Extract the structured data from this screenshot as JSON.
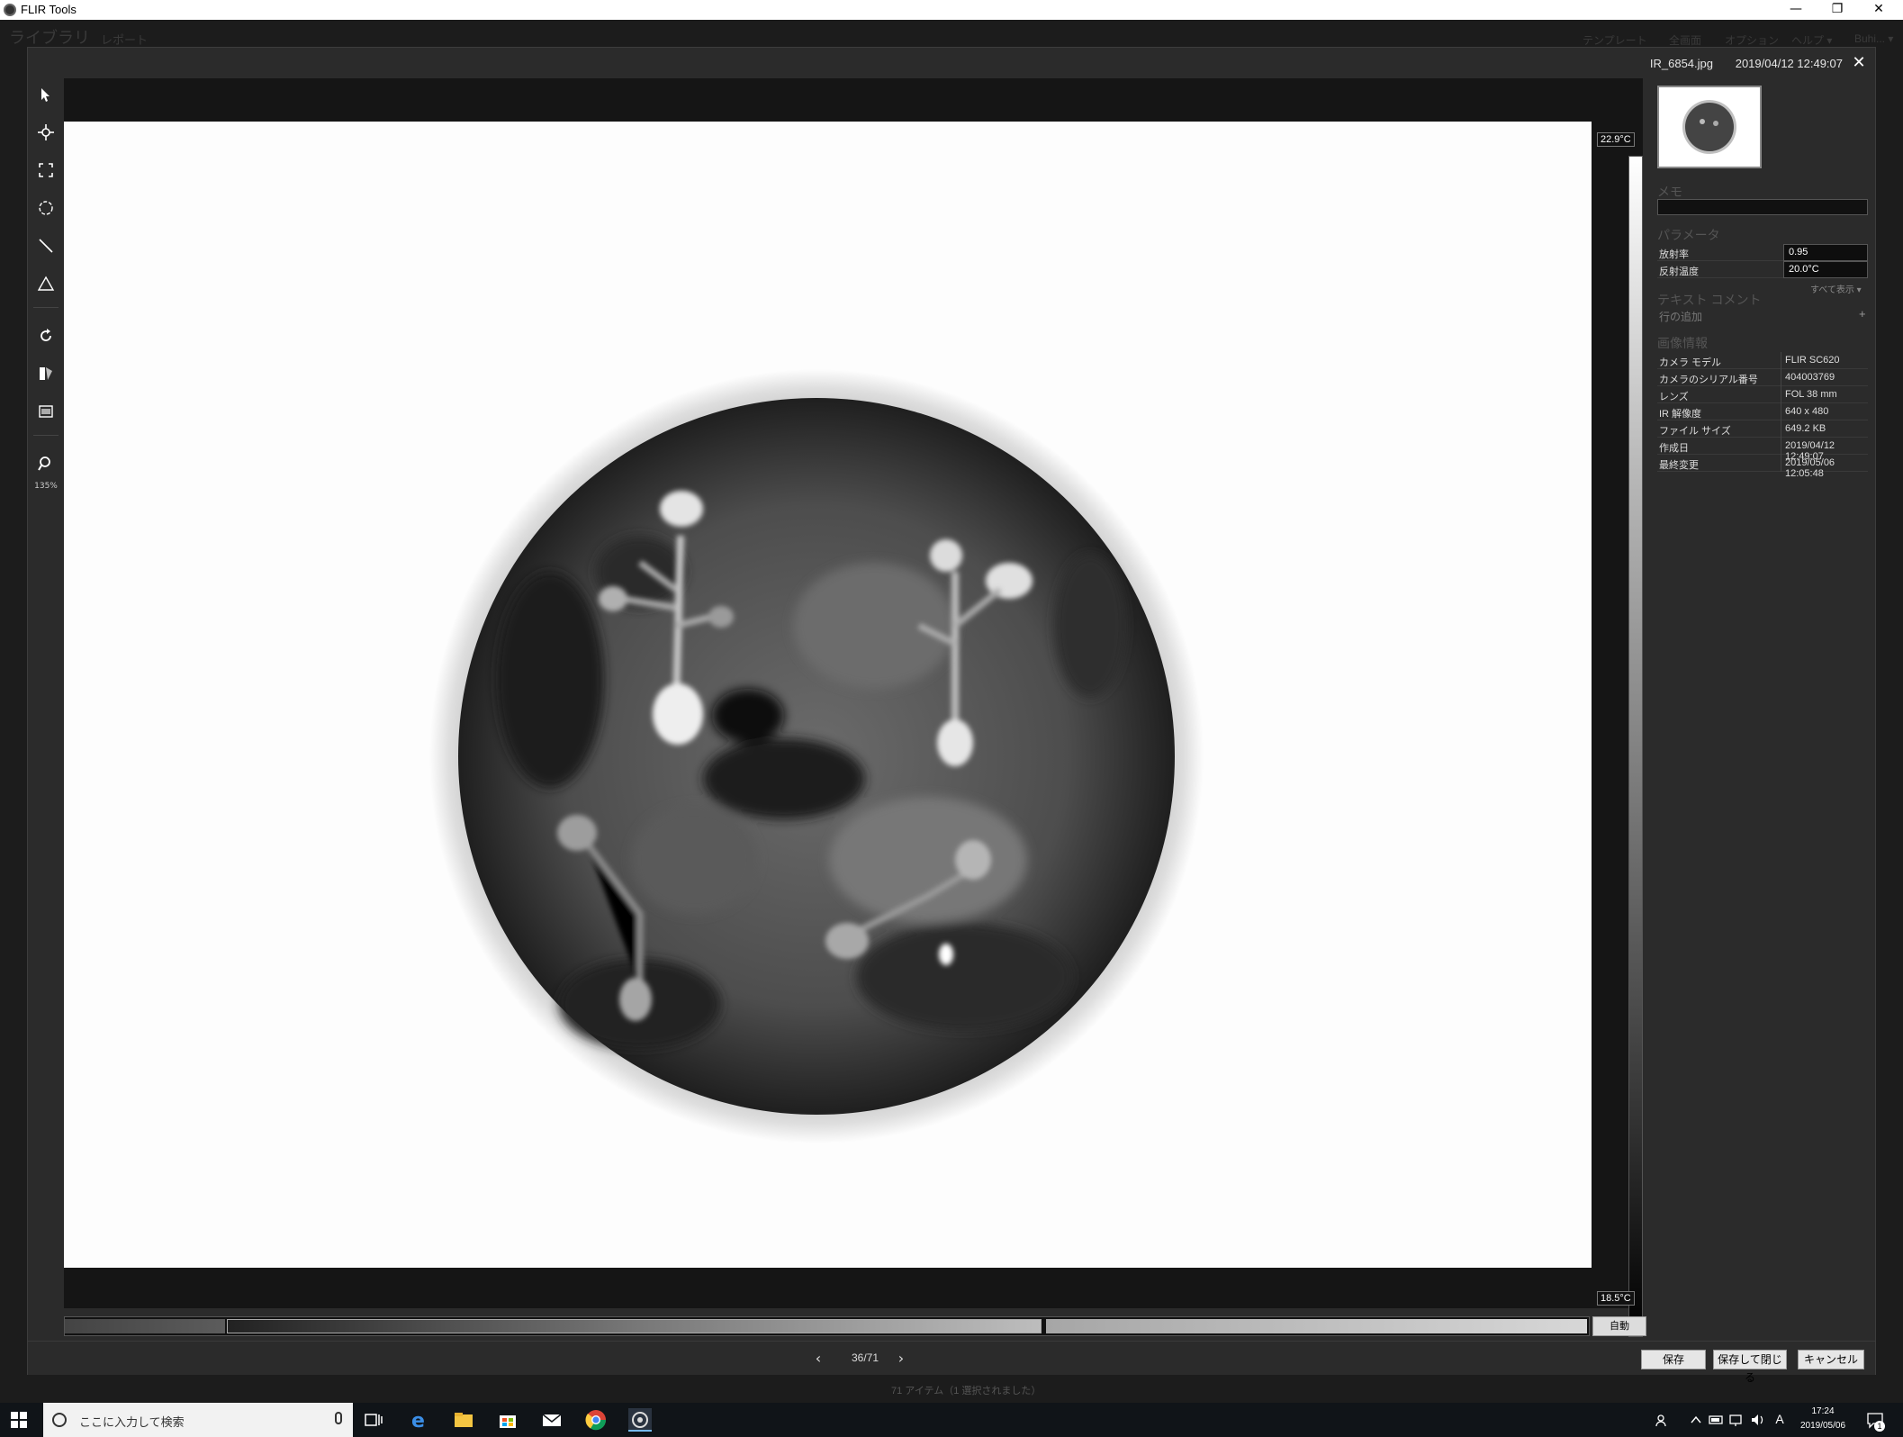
{
  "os": {
    "app_title": "FLIR Tools",
    "minimize": "—",
    "restore": "❐",
    "close": "✕"
  },
  "background_app": {
    "library_tab": "ライブラリ",
    "report_tab": "レポート",
    "template_menu": "テンプレート",
    "fullscreen_menu": "全画面",
    "options_menu": "オプション",
    "help_menu": "ヘルプ ▾",
    "user_menu": "Buhi... ▾"
  },
  "editor": {
    "file_name": "IR_6854.jpg",
    "date": "2019/04/12 12:49:07",
    "close_glyph": "✕",
    "zoom_level": "135%",
    "temp_max": "22.9°C",
    "temp_min": "18.5°C",
    "auto_label": "自動",
    "nav_prev": "‹",
    "nav_next": "›",
    "nav_count": "36/71",
    "save_label": "保存",
    "save_close_label": "保存して閉じる",
    "cancel_label": "キャンセル",
    "palette": "grayscale (iron off)"
  },
  "right_panel": {
    "memo_title": "メモ",
    "params_title": "パラメータ",
    "params": [
      {
        "key": "放射率",
        "value": "0.95"
      },
      {
        "key": "反射温度",
        "value": "20.0°C"
      }
    ],
    "show_all": "すべて表示 ▾",
    "text_comment_title": "テキスト コメント",
    "add_row": "行の追加",
    "add_row_plus": "+",
    "image_info_title": "画像情報",
    "info": [
      {
        "key": "カメラ モデル",
        "value": "FLIR SC620"
      },
      {
        "key": "カメラのシリアル番号",
        "value": "404003769"
      },
      {
        "key": "レンズ",
        "value": "FOL 38 mm"
      },
      {
        "key": "IR 解像度",
        "value": "640 x 480"
      },
      {
        "key": "ファイル サイズ",
        "value": "649.2 KB"
      },
      {
        "key": "作成日",
        "value": "2019/04/12 12:49:07"
      },
      {
        "key": "最終変更",
        "value": "2019/05/06 12:05:48"
      }
    ]
  },
  "status_text": "71 アイテム（1 選択されました）",
  "taskbar": {
    "search_placeholder": "ここに入力して検索",
    "time": "17:24",
    "date": "2019/05/06",
    "ime": "A",
    "notification_count": "1"
  },
  "colors": {
    "panel_bg": "#2b2b2b",
    "canvas_bg": "#151515",
    "taskbar_bg": "#101418",
    "accent": "#e6e6e6"
  }
}
